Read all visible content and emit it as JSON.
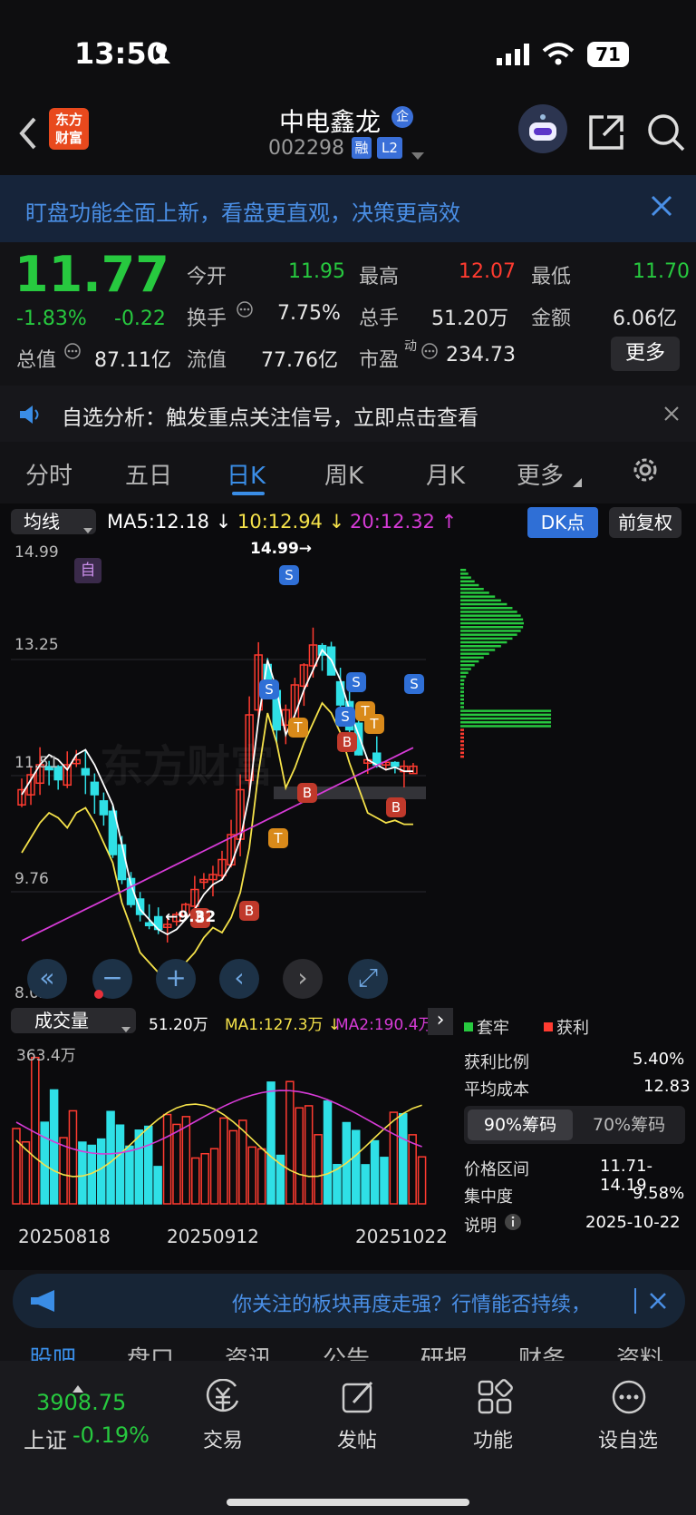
{
  "status_bar": {
    "time": "13:50",
    "battery": "71"
  },
  "header": {
    "app_logo": "东方\n财富",
    "stock_name": "中电鑫龙",
    "badge_qi": "企",
    "code": "002298",
    "tag_rong": "融",
    "tag_l2": "L2"
  },
  "notice_banner": {
    "text": "盯盘功能全面上新，看盘更直观，决策更高效"
  },
  "quote": {
    "price": "11.77",
    "change_pct": "-1.83%",
    "change": "-0.22",
    "open_label": "今开",
    "open": "11.95",
    "high_label": "最高",
    "high": "12.07",
    "low_label": "最低",
    "low": "11.70",
    "turnover_label": "换手",
    "turnover": "7.75%",
    "volume_label": "总手",
    "volume": "51.20万",
    "amount_label": "金额",
    "amount": "6.06亿",
    "mktcap_label": "总值",
    "mktcap": "87.11亿",
    "float_label": "流值",
    "float": "77.76亿",
    "pe_label": "市盈",
    "pe_sup": "动",
    "pe": "234.73",
    "more": "更多"
  },
  "analysis_banner": {
    "text": "自选分析：触发重点关注信号，立即点击查看"
  },
  "tabs": [
    "分时",
    "五日",
    "日K",
    "周K",
    "月K",
    "更多"
  ],
  "active_tab": "日K",
  "ma_bar": {
    "selector": "均线",
    "ma5": "MA5:12.18 ↓",
    "ma10": "10:12.94 ↓",
    "ma20": "20:12.32 ↑",
    "dk": "DK点",
    "fq": "前复权"
  },
  "price_axis": {
    "t1": "14.99",
    "t2": "13.25",
    "t3": "11.51",
    "t4": "9.76",
    "t5": "8.02"
  },
  "annotations": {
    "high": "14.99→",
    "low": "←9.32",
    "self": "自",
    "watermark": "东方财富"
  },
  "volume_bar": {
    "selector": "成交量",
    "vol": "51.20万",
    "ma1": "MA1:127.3万 ↓",
    "ma2": "MA2:190.4万",
    "max": "363.4万"
  },
  "x_axis": {
    "d1": "20250818",
    "d2": "20250912",
    "d3": "20251022"
  },
  "chips": {
    "legend_tight": "套牢",
    "legend_profit": "获利",
    "profit_ratio_label": "获利比例",
    "profit_ratio": "5.40%",
    "avg_cost_label": "平均成本",
    "avg_cost": "12.83",
    "tab90": "90%筹码",
    "tab70": "70%筹码",
    "range_label": "价格区间",
    "range": "11.71-14.19",
    "conc_label": "集中度",
    "conc": "9.58%",
    "note_label": "说明",
    "note_date": "2025-10-22"
  },
  "news_banner": {
    "text": "你关注的板块再度走强？行情能否持续，"
  },
  "sub_tabs": [
    "股吧",
    "盘口",
    "资讯",
    "公告",
    "研报",
    "财务",
    "资料"
  ],
  "bottom_bar": {
    "index_value": "3908.75",
    "index_name": "上证",
    "index_change": "-0.19%",
    "trade": "交易",
    "post": "发帖",
    "func": "功能",
    "watch": "设自选"
  },
  "colors": {
    "up": "#ff3b30",
    "down": "#27c93f",
    "candle_down": "#2fe0e6",
    "ma5": "#ffffff",
    "ma10": "#f5e24a",
    "ma20": "#d63bd6",
    "accent": "#2f6fd6"
  }
}
